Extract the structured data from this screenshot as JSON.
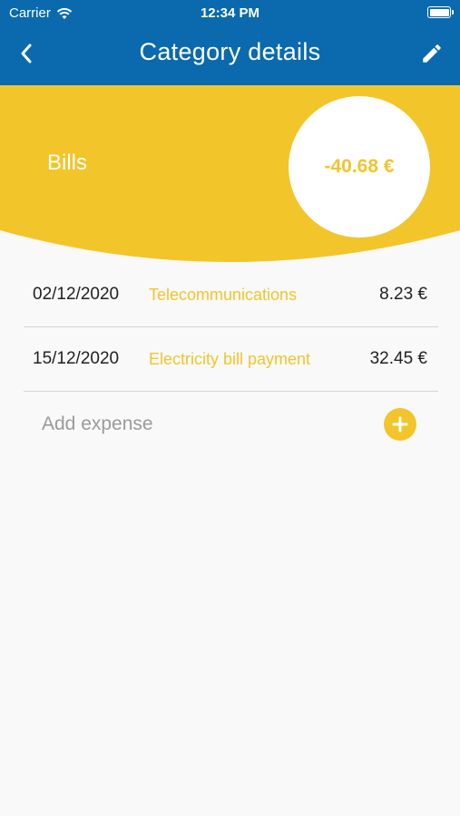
{
  "status_bar": {
    "carrier": "Carrier",
    "time": "12:34 PM"
  },
  "nav": {
    "title": "Category details"
  },
  "category": {
    "name": "Bills",
    "total": "-40.68 €"
  },
  "expenses": [
    {
      "date": "02/12/2020",
      "description": "Telecommunications",
      "amount": "8.23 €"
    },
    {
      "date": "15/12/2020",
      "description": "Electricity bill payment",
      "amount": "32.45 €"
    }
  ],
  "add_expense": {
    "label": "Add expense"
  },
  "colors": {
    "header_blue": "#0a6aad",
    "accent_yellow": "#f2c52b",
    "background": "#f9f9f9"
  },
  "icons": {
    "back": "chevron-left-icon",
    "edit": "pencil-icon",
    "add": "plus-circle-icon",
    "wifi": "wifi-icon",
    "battery": "battery-icon"
  }
}
